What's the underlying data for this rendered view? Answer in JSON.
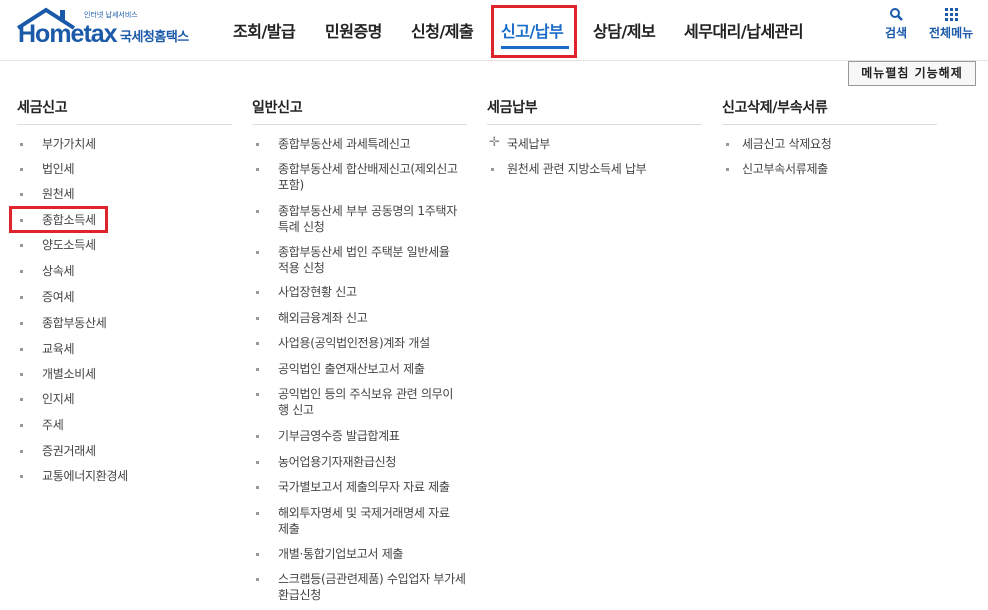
{
  "logo": {
    "word": "Hometax",
    "tag": "인터넷 납세서비스",
    "kr": "국세청홈택스"
  },
  "gnb": [
    {
      "label": "조회/발급"
    },
    {
      "label": "민원증명"
    },
    {
      "label": "신청/제출"
    },
    {
      "label": "신고/납부",
      "active": true
    },
    {
      "label": "상담/제보"
    },
    {
      "label": "세무대리/납세관리"
    }
  ],
  "util": {
    "search": "검색",
    "all_menu": "전체메뉴"
  },
  "toggle_button": "메뉴펼침 기능해제",
  "columns": [
    {
      "title": "세금신고",
      "items": [
        "부가가치세",
        "법인세",
        "원천세",
        "종합소득세",
        "양도소득세",
        "상속세",
        "증여세",
        "종합부동산세",
        "교육세",
        "개별소비세",
        "인지세",
        "주세",
        "증권거래세",
        "교통에너지환경세"
      ]
    },
    {
      "title": "일반신고",
      "items": [
        [
          "종합부동산세 과세특례신고"
        ],
        [
          "종합부동산세 합산배제신고(제외신고",
          "포함)"
        ],
        [
          "종합부동산세 부부 공동명의 1주택자",
          "특례 신청"
        ],
        [
          "종합부동산세 법인 주택분 일반세율",
          "적용 신청"
        ],
        [
          "사업장현황 신고"
        ],
        [
          "해외금융계좌 신고"
        ],
        [
          "사업용(공익법인전용)계좌 개설"
        ],
        [
          "공익법인 출연재산보고서 제출"
        ],
        [
          "공익법인 등의 주식보유 관련 의무이",
          "행 신고"
        ],
        [
          "기부금영수증 발급합계표"
        ],
        [
          "농어업용기자재환급신청"
        ],
        [
          "국가별보고서 제출의무자 자료 제출"
        ],
        [
          "해외투자명세 및 국제거래명세 자료",
          "제출"
        ],
        [
          "개별·통합기업보고서 제출"
        ],
        [
          "스크랩등(금관련제품) 수입업자 부가세",
          "환급신청"
        ]
      ]
    },
    {
      "title": "세금납부",
      "items": [
        "국세납부",
        "원천세 관련 지방소득세 납부"
      ]
    },
    {
      "title": "신고삭제/부속서류",
      "items": [
        "세금신고 삭제요청",
        "신고부속서류제출"
      ]
    }
  ]
}
